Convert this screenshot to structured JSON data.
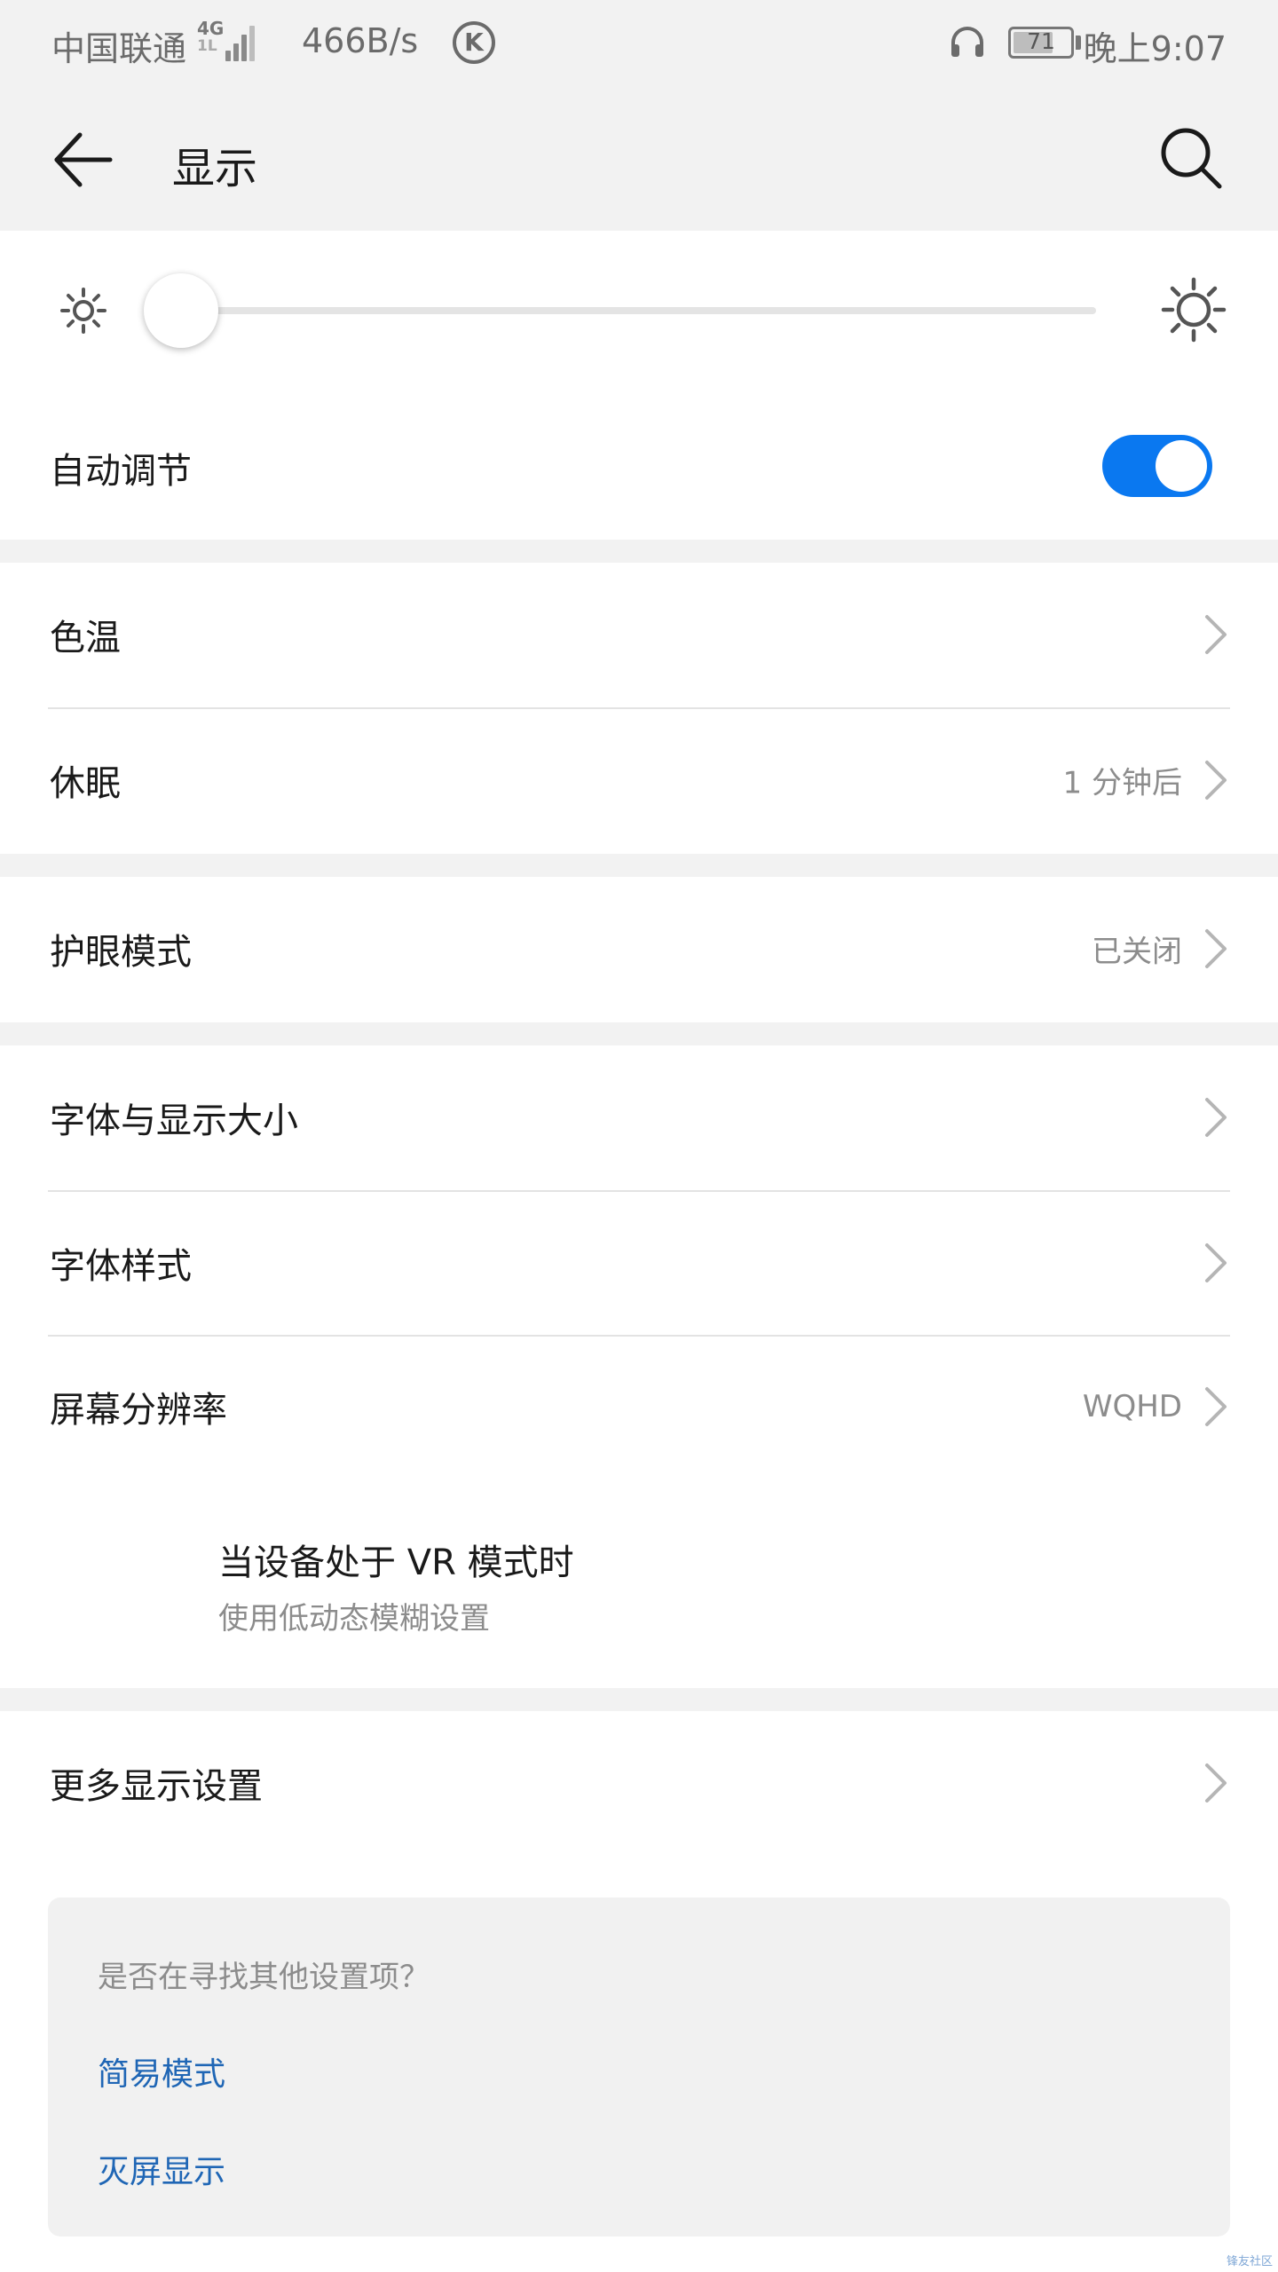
{
  "status_bar": {
    "carrier": "中国联通",
    "network_type": "4G",
    "network_sub": "1L",
    "net_speed": "466B/s",
    "k_badge": "K",
    "battery_level": "71",
    "battery_fraction": 0.71,
    "time": "晚上9:07"
  },
  "header": {
    "title": "显示"
  },
  "brightness": {
    "level": 0.0,
    "auto_adjust_label": "自动调节",
    "auto_adjust_on": true,
    "accent_color": "#0a78f0"
  },
  "settings": {
    "color_temp": {
      "label": "色温"
    },
    "sleep": {
      "label": "休眠",
      "value": "1 分钟后"
    },
    "eye_comfort": {
      "label": "护眼模式",
      "value": "已关闭"
    },
    "font_size": {
      "label": "字体与显示大小"
    },
    "font_style": {
      "label": "字体样式"
    },
    "resolution": {
      "label": "屏幕分辨率",
      "value": "WQHD"
    },
    "vr": {
      "title": "当设备处于 VR 模式时",
      "subtitle": "使用低动态模糊设置"
    },
    "more": {
      "label": "更多显示设置"
    }
  },
  "suggestions": {
    "question": "是否在寻找其他设置项？",
    "links": [
      "简易模式",
      "灭屏显示"
    ],
    "link_color": "#1f66b5"
  },
  "watermark": "锋友社区",
  "icons": {
    "back": "arrow-left-icon",
    "search": "search-icon",
    "brightness_low": "sun-small-icon",
    "brightness_high": "sun-large-icon",
    "chevron": "chevron-right-icon"
  }
}
